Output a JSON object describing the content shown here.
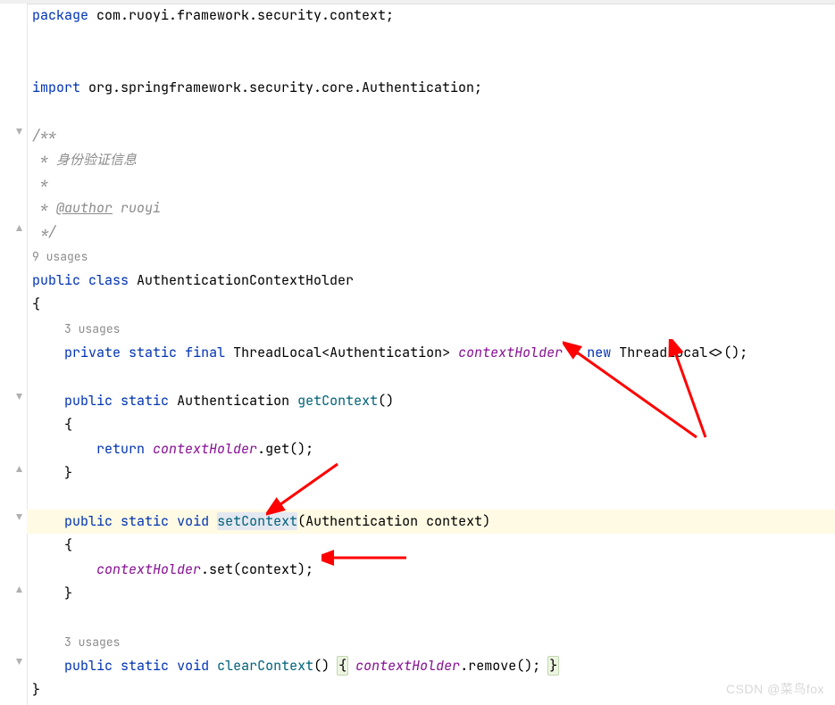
{
  "package_kw": "package",
  "package_name": " com.ruoyi.framework.security.context;",
  "import_kw": "import",
  "import_name": " org.springframework.security.core.Authentication;",
  "doc_open": "/**",
  "doc_star": " * ",
  "doc_desc": "身份验证信息",
  "doc_author_tag": "@author",
  "doc_author_val": " ruoyi",
  "doc_close": " */",
  "usages_9": "9 usages",
  "usages_3": "3 usages",
  "kw_public": "public",
  "kw_class": "class",
  "kw_private": "private",
  "kw_static": "static",
  "kw_final": "final",
  "kw_void": "void",
  "kw_new": "new",
  "kw_return": "return",
  "class_name": " AuthenticationContextHolder",
  "type_ThreadLocal": "ThreadLocal",
  "type_Auth": "Authentication",
  "field_ctx": "contextHolder",
  "m_get": "getContext",
  "m_set": "setContext",
  "m_clear": "clearContext",
  "param_ctx": "context",
  "call_get": ".get();",
  "call_set": ".set(context);",
  "call_remove": ".remove(); ",
  "lbrace": "{",
  "rbrace": "}",
  "watermark": "CSDN @菜鸟fox"
}
